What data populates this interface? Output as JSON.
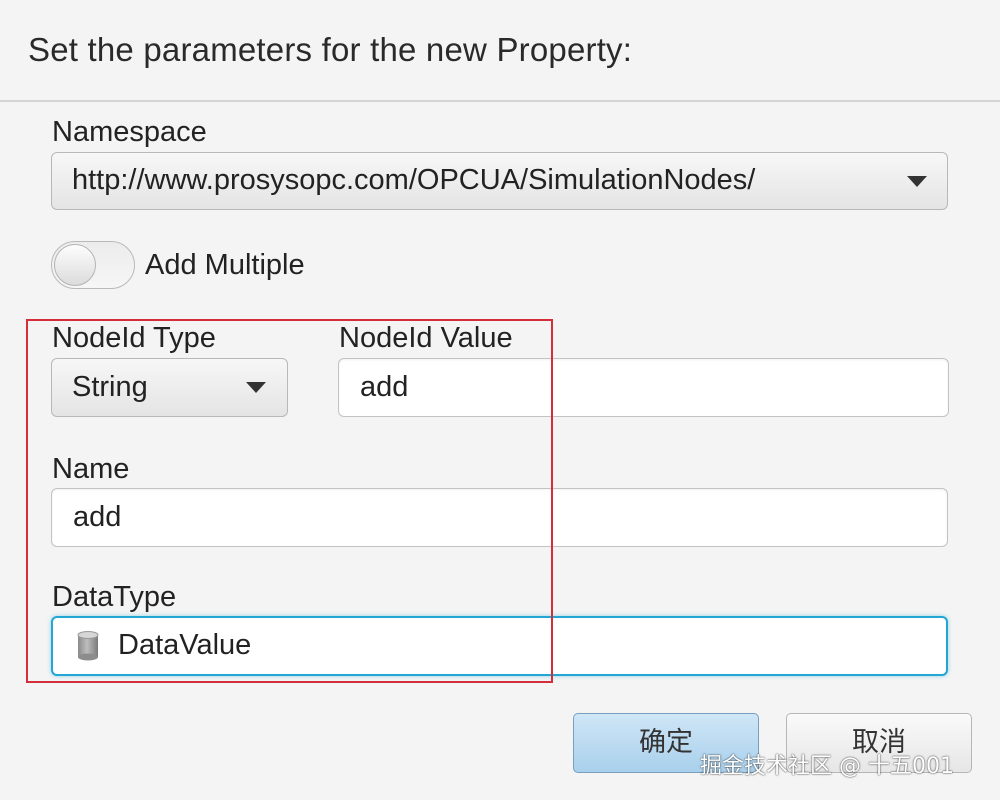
{
  "dialog": {
    "title": "Set the parameters for the new Property:"
  },
  "namespace": {
    "label": "Namespace",
    "value": "http://www.prosysopc.com/OPCUA/SimulationNodes/"
  },
  "add_multiple": {
    "label": "Add Multiple",
    "enabled": false
  },
  "nodeid_type": {
    "label": "NodeId Type",
    "value": "String"
  },
  "nodeid_value": {
    "label": "NodeId Value",
    "value": "add"
  },
  "name": {
    "label": "Name",
    "value": "add"
  },
  "datatype": {
    "label": "DataType",
    "value": "DataValue",
    "icon": "database-icon"
  },
  "buttons": {
    "ok_label": "确定",
    "cancel_label": "取消"
  },
  "watermark": "掘金技术社区 @ 十五001",
  "colors": {
    "highlight_border": "#d32f3a",
    "focus_border": "#22a6d4",
    "ok_button": "#bcdcf2"
  }
}
